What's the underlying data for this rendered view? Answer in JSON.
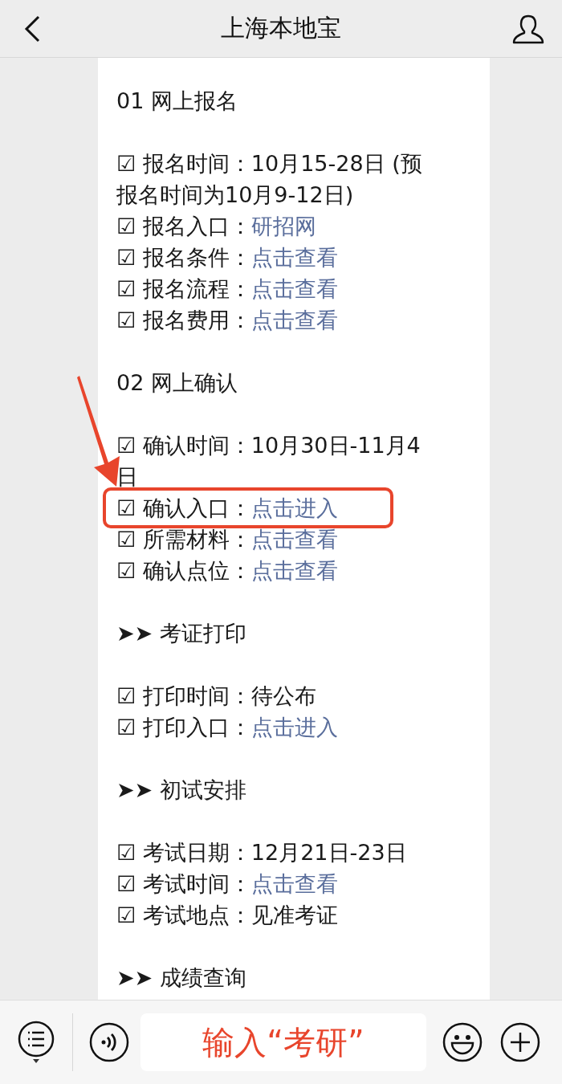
{
  "nav": {
    "title": "上海本地宝"
  },
  "sections": [
    {
      "heading": "01 网上报名",
      "items": [
        {
          "label": "☑ 报名时间：10月15-28日 (预报名时间为10月9-12日)",
          "highlighted": false
        },
        {
          "label": "☑ 报名入口：",
          "link": "研招网",
          "highlighted": false
        },
        {
          "label": "☑ 报名条件：",
          "link": "点击查看",
          "highlighted": false
        },
        {
          "label": "☑ 报名流程：",
          "link": "点击查看",
          "highlighted": false
        },
        {
          "label": "☑ 报名费用：",
          "link": "点击查看",
          "highlighted": false
        }
      ]
    },
    {
      "heading": "02 网上确认",
      "items": [
        {
          "label": "☑ 确认时间：10月30日-11月4日",
          "highlighted": false
        },
        {
          "label": "☑ 确认入口：",
          "link": "点击进入",
          "highlighted": true
        },
        {
          "label": "☑ 所需材料：",
          "link": "点击查看",
          "highlighted": false
        },
        {
          "label": "☑ 确认点位：",
          "link": "点击查看",
          "highlighted": false
        }
      ]
    },
    {
      "heading": "➤➤ 考证打印",
      "items": [
        {
          "label": "☑ 打印时间：待公布",
          "highlighted": false
        },
        {
          "label": "☑ 打印入口：",
          "link": "点击进入",
          "highlighted": false
        }
      ]
    },
    {
      "heading": "➤➤ 初试安排",
      "items": [
        {
          "label": "☑ 考试日期：12月21日-23日",
          "highlighted": false
        },
        {
          "label": "☑ 考试时间：",
          "link": "点击查看",
          "highlighted": false
        },
        {
          "label": "☑ 考试地点：见准考证",
          "highlighted": false
        }
      ]
    },
    {
      "heading": "➤➤ 成绩查询"
    }
  ],
  "input_bar": {
    "value": "输入“考研”"
  }
}
